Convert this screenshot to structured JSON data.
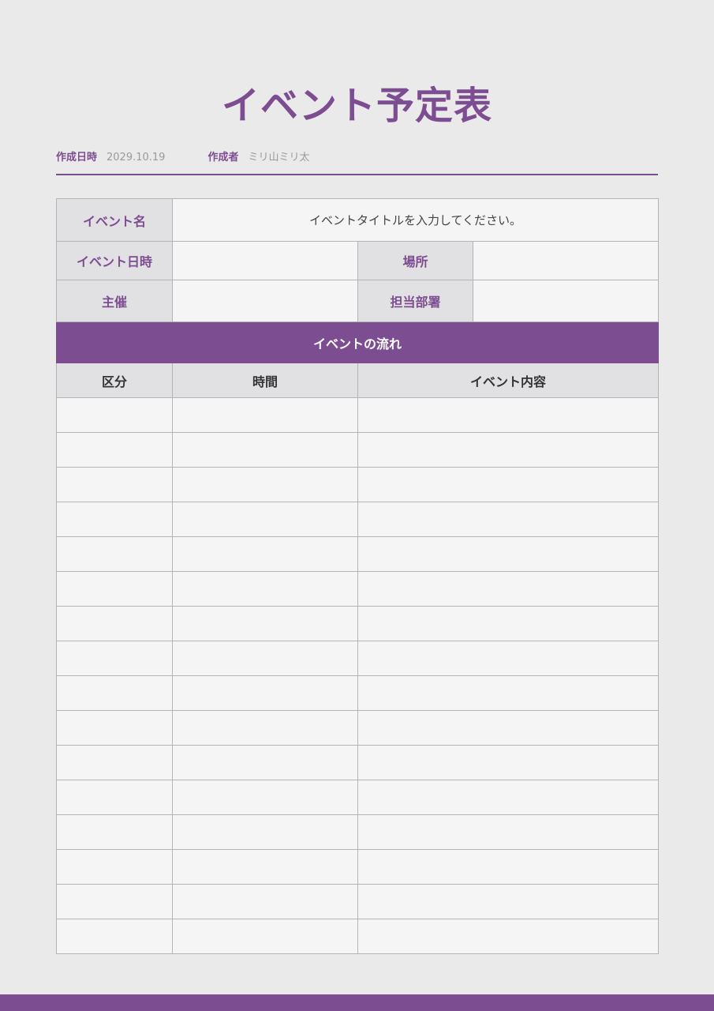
{
  "title": "イベント予定表",
  "meta": {
    "created_date_label": "作成日時",
    "created_date_value": "2029.10.19",
    "author_label": "作成者",
    "author_value": "ミリ山ミリ太"
  },
  "info": {
    "event_name_label": "イベント名",
    "event_name_value": "イベントタイトルを入力してください。",
    "event_datetime_label": "イベント日時",
    "event_datetime_value": "",
    "location_label": "場所",
    "location_value": "",
    "organizer_label": "主催",
    "organizer_value": "",
    "department_label": "担当部署",
    "department_value": ""
  },
  "flow": {
    "title": "イベントの流れ",
    "columns": [
      "区分",
      "時間",
      "イベント内容"
    ],
    "rows": [
      [
        "",
        "",
        ""
      ],
      [
        "",
        "",
        ""
      ],
      [
        "",
        "",
        ""
      ],
      [
        "",
        "",
        ""
      ],
      [
        "",
        "",
        ""
      ],
      [
        "",
        "",
        ""
      ],
      [
        "",
        "",
        ""
      ],
      [
        "",
        "",
        ""
      ],
      [
        "",
        "",
        ""
      ],
      [
        "",
        "",
        ""
      ],
      [
        "",
        "",
        ""
      ],
      [
        "",
        "",
        ""
      ],
      [
        "",
        "",
        ""
      ],
      [
        "",
        "",
        ""
      ],
      [
        "",
        "",
        ""
      ],
      [
        "",
        "",
        ""
      ]
    ]
  },
  "colors": {
    "accent": "#7d4d91",
    "header_cell": "#e1e0e2",
    "body_cell": "#f6f5f6",
    "page_bg": "#ebeaeb"
  }
}
